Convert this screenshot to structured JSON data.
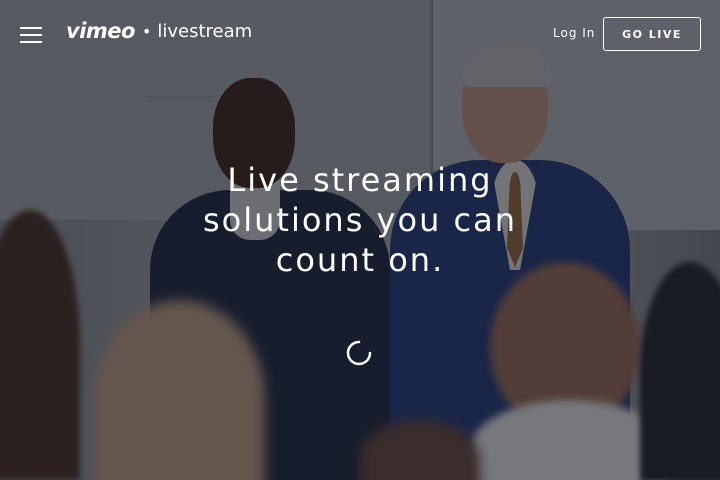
{
  "header": {
    "logo_primary": "vimeo",
    "logo_separator": "•",
    "logo_secondary": "livestream",
    "login_label": "Log In",
    "cta_label": "GO LIVE"
  },
  "hero": {
    "headline_line1": "Live streaming",
    "headline_line2": "solutions you can",
    "headline_line3": "count on."
  },
  "icons": {
    "menu": "hamburger-menu-icon",
    "loading": "loading-spinner-icon"
  },
  "colors": {
    "text": "#ffffff",
    "overlay": "rgba(20,22,30,0.55)"
  }
}
